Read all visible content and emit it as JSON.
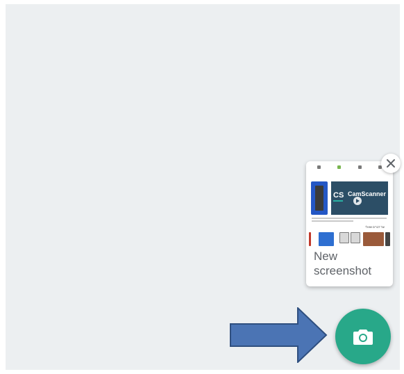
{
  "screenshot_card": {
    "label": "New\nscreenshot",
    "thumbnail": {
      "app_title": "CamScanner",
      "logo_text": "CS",
      "section_heading": "עוד דברים שאולי",
      "banner_color": "#2c4e66",
      "phone_color": "#2457c5"
    }
  },
  "close_button": {
    "icon": "close-icon"
  },
  "capture_button": {
    "icon": "camera-icon",
    "color": "#28a889"
  },
  "annotation_arrow": {
    "color": "#4b74b4"
  }
}
